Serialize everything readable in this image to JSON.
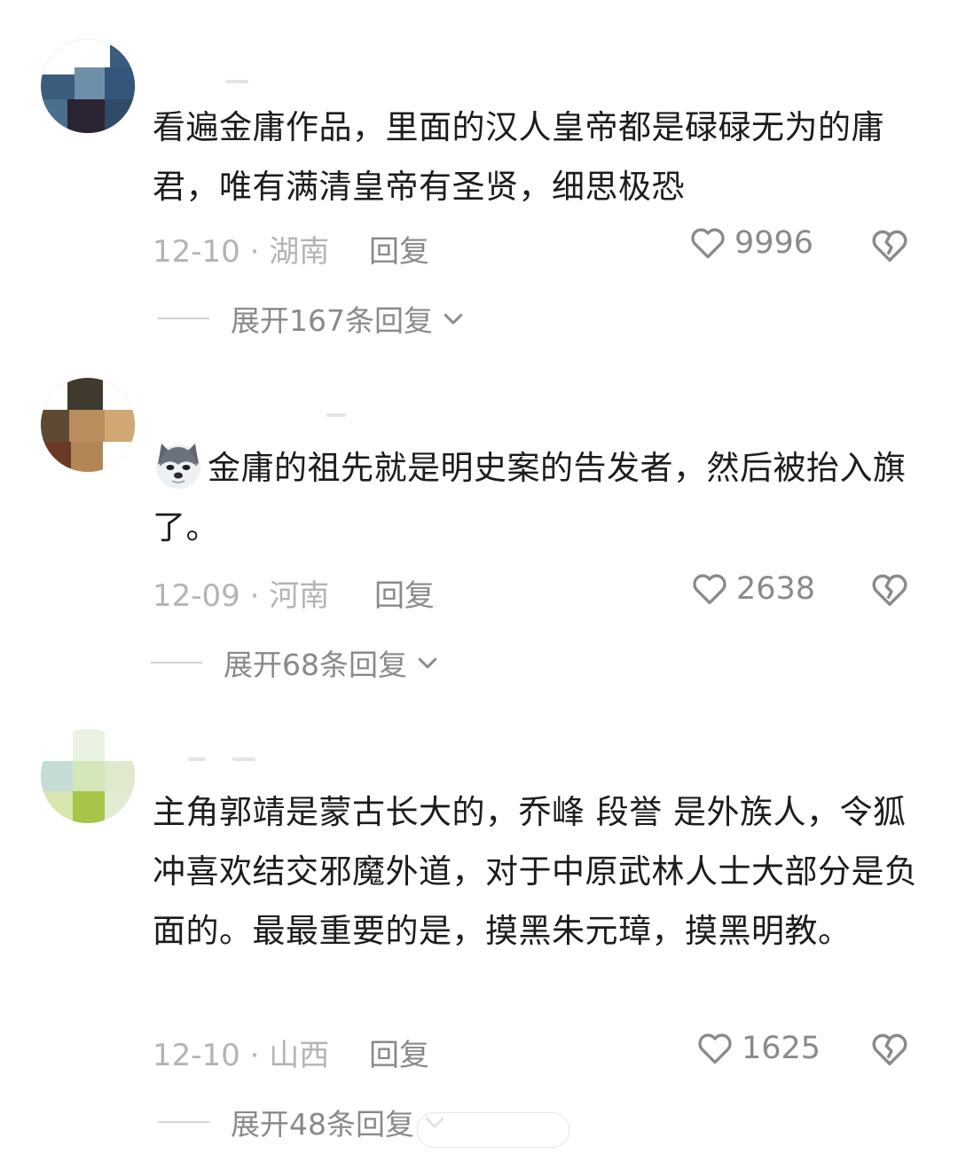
{
  "comments": [
    {
      "text": "看遍金庸作品，里面的汉人皇帝都是碌碌无为的庸君，唯有满清皇帝有圣贤，细思极恐",
      "date_location": "12-10 · 湖南",
      "reply_label": "回复",
      "like_count": "9996",
      "expand_label": "展开167条回复"
    },
    {
      "text": "金庸的祖先就是明史案的告发者，然后被抬入旗了。",
      "date_location": "12-09 · 河南",
      "reply_label": "回复",
      "like_count": "2638",
      "expand_label": "展开68条回复"
    },
    {
      "text": "主角郭靖是蒙古长大的，乔峰 段誉 是外族人，令狐冲喜欢结交邪魔外道，对于中原武林人士大部分是负面的。最最重要的是，摸黑朱元璋，摸黑明教。",
      "date_location": "12-10 · 山西",
      "reply_label": "回复",
      "like_count": "1625",
      "expand_label": "展开48条回复"
    }
  ],
  "icons": {
    "like": "heart-outline-icon",
    "dislike": "broken-heart-icon",
    "expand": "chevron-down-icon",
    "emoji": "husky-dog-emoji-icon"
  },
  "colors": {
    "text": "#1c1c1c",
    "meta_light": "#b4b4b4",
    "meta": "#8a8a8a",
    "background": "#ffffff"
  }
}
